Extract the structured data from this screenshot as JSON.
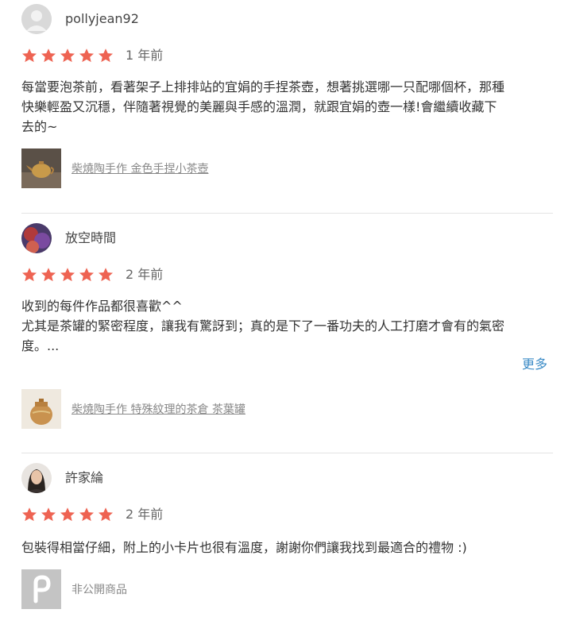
{
  "reviews": [
    {
      "username": "pollyjean92",
      "rating": 5,
      "time": "1 年前",
      "lines": [
        "每當要泡茶前，看著架子上排排站的宜娟的手捏茶壺，想著挑選哪一只配哪個杯，那種",
        "快樂輕盈又沉穩，伴隨著視覺的美麗與手感的溫潤，就跟宜娟的壺一樣!會繼續收藏下",
        "去的~"
      ],
      "product": "柴燒陶手作 金色手捏小茶壺",
      "avatar_icon": "default-user-icon",
      "thumb_icon": "teapot-photo"
    },
    {
      "username": "放空時間",
      "rating": 5,
      "time": "2 年前",
      "lines": [
        "收到的每件作品都很喜歡^^",
        "尤其是茶罐的緊密程度，讓我有驚訝到；真的是下了一番功夫的人工打磨才會有的氣密",
        "度。..."
      ],
      "more": "更多",
      "product": "柴燒陶手作 特殊紋理的茶倉 茶葉罐",
      "avatar_icon": "user-photo",
      "thumb_icon": "tea-jar-photo"
    },
    {
      "username": "許家綸",
      "rating": 5,
      "time": "2 年前",
      "lines": [
        "包裝得相當仔細，附上的小卡片也很有溫度，謝謝你們讓我找到最適合的禮物 :)"
      ],
      "product": "非公開商品",
      "avatar_icon": "user-photo",
      "thumb_icon": "pinkoi-logo-icon"
    }
  ],
  "colors": {
    "star": "#ee6352",
    "link": "#3b8bc6",
    "divider": "#e4e4e4"
  }
}
